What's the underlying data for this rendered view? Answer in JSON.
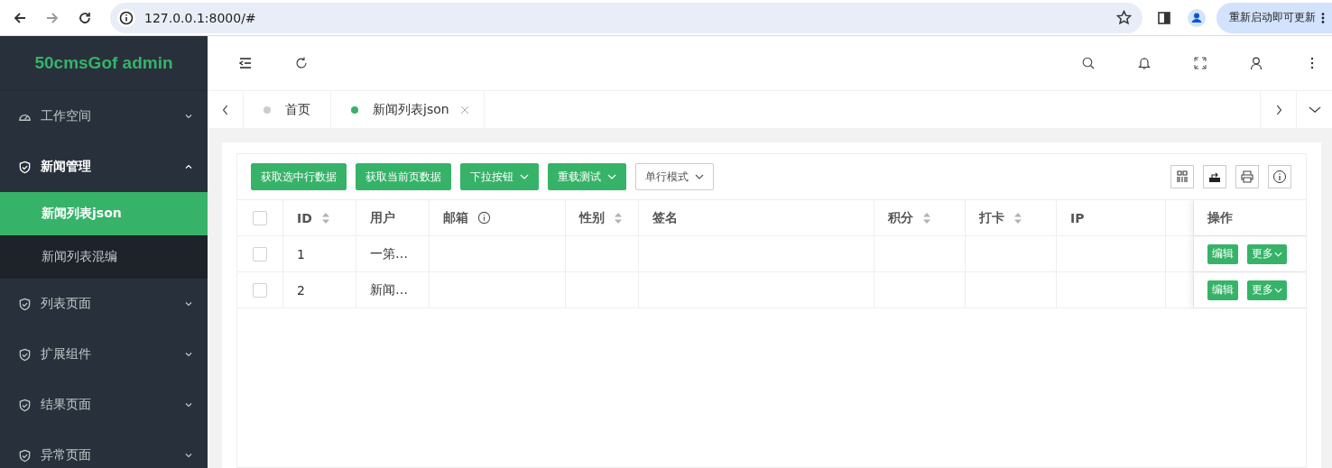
{
  "browser": {
    "url": "127.0.0.1:8000/#",
    "update_button": "重新启动即可更新"
  },
  "sidebar": {
    "logo": "50cmsGof admin",
    "items": [
      {
        "label": "工作空间",
        "expanded": false
      },
      {
        "label": "新闻管理",
        "expanded": true,
        "children": [
          {
            "label": "新闻列表json",
            "selected": true
          },
          {
            "label": "新闻列表混编",
            "selected": false
          }
        ]
      },
      {
        "label": "列表页面",
        "expanded": false
      },
      {
        "label": "扩展组件",
        "expanded": false
      },
      {
        "label": "结果页面",
        "expanded": false
      },
      {
        "label": "异常页面",
        "expanded": false
      }
    ]
  },
  "tabs": [
    {
      "label": "首页",
      "selected": false,
      "closable": false
    },
    {
      "label": "新闻列表json",
      "selected": true,
      "closable": true
    }
  ],
  "toolbar": {
    "buttons": [
      {
        "label": "获取选中行数据",
        "kind": "primary"
      },
      {
        "label": "获取当前页数据",
        "kind": "primary"
      },
      {
        "label": "下拉按钮",
        "kind": "primary-dropdown"
      },
      {
        "label": "重载测试",
        "kind": "primary-dropdown"
      },
      {
        "label": "单行模式",
        "kind": "plain-dropdown"
      }
    ]
  },
  "table": {
    "select_all_checked": false,
    "columns": [
      {
        "label": "ID",
        "sortable": true,
        "info": false
      },
      {
        "label": "用户",
        "sortable": false,
        "info": false
      },
      {
        "label": "邮箱",
        "sortable": false,
        "info": true
      },
      {
        "label": "性别",
        "sortable": true,
        "info": false
      },
      {
        "label": "签名",
        "sortable": false,
        "info": false
      },
      {
        "label": "积分",
        "sortable": true,
        "info": false
      },
      {
        "label": "打卡",
        "sortable": true,
        "info": false
      },
      {
        "label": "IP",
        "sortable": false,
        "info": false
      }
    ],
    "actions_header": "操作",
    "rows": [
      {
        "checked": false,
        "id": "1",
        "user": "一第…",
        "edit": "编辑",
        "more": "更多"
      },
      {
        "checked": false,
        "id": "2",
        "user": "新闻…",
        "edit": "编辑",
        "more": "更多"
      }
    ]
  }
}
